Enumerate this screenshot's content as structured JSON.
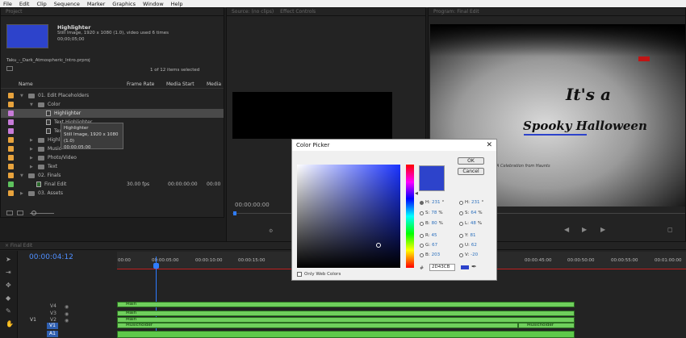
{
  "menu": [
    "File",
    "Edit",
    "Clip",
    "Sequence",
    "Marker",
    "Graphics",
    "Window",
    "Help"
  ],
  "project": {
    "tab_label": "Project",
    "preview_name": "Highlighter",
    "preview_info": "Still Image, 1920 x 1080 (1.0)",
    "preview_used": ", video used 6 times",
    "preview_duration": "00;00;05;00",
    "project_file": "Taku_-_Dark_Atmospheric_Intro.prproj",
    "selection_info": "1 of 12 items selected",
    "columns": [
      "Name",
      "Frame Rate",
      "Media Start",
      "Media"
    ],
    "rows": [
      {
        "label": "01. Edit Placeholders",
        "color": "#e8a33d",
        "type": "folder"
      },
      {
        "label": "Color",
        "color": "#e8a33d",
        "type": "folder"
      },
      {
        "label": "Highlighter",
        "color": "#c77bd8",
        "type": "file"
      },
      {
        "label": "Text Highlighter",
        "color": "#c77bd8",
        "type": "file"
      },
      {
        "label": "Text",
        "color": "#c77bd8",
        "type": "file"
      },
      {
        "label": "Highlighted Video",
        "color": "#e8a33d",
        "type": "folder"
      },
      {
        "label": "Music",
        "color": "#e8a33d",
        "type": "folder"
      },
      {
        "label": "Photo/Video",
        "color": "#e8a33d",
        "type": "folder"
      },
      {
        "label": "Text",
        "color": "#e8a33d",
        "type": "folder"
      },
      {
        "label": "02. Finals",
        "color": "#e8a33d",
        "type": "folder"
      },
      {
        "label": "Final Edit",
        "color": "#5ec25e",
        "type": "file"
      },
      {
        "label": "03. Assets",
        "color": "#e8a33d",
        "type": "folder"
      }
    ],
    "final_edit_fps": "30.00 fps",
    "final_edit_start": "00:00:00:00",
    "final_edit_media": "00:00",
    "tooltip": {
      "name": "Highlighter",
      "info": "Still Image, 1920 x 1080 (1.0)",
      "duration": "00:00:05:00"
    }
  },
  "source": {
    "tab_label": "Source: (no clips)",
    "tab_label2": "Effect Controls",
    "timecode": "00:00:00:00"
  },
  "program": {
    "tab_label": "Program: Final Edit",
    "title_line1": "It's a",
    "title_line2": "Spooky Halloween",
    "subtitle": "A Celebration from Haunts"
  },
  "timeline": {
    "timecode": "00:00:04:12",
    "ruler": [
      "00:00",
      "00:00:05:00",
      "00:00:10:00",
      "00:00:15:00",
      "00:00:45:00",
      "00:00:50:00",
      "00:00:55:00",
      "00:01:00:00"
    ],
    "tracks": [
      "V4",
      "V3",
      "V2",
      "V1",
      "A1"
    ],
    "source_patch": "V1",
    "clips": {
      "main1": "Main",
      "main2": "Main",
      "main3": "Main",
      "music1": "Musicholder",
      "music2": "Musicholder"
    }
  },
  "color_picker": {
    "title": "Color Picker",
    "ok": "OK",
    "cancel": "Cancel",
    "swatch_color": "#2D43CB",
    "only_web_colors": "Only Web Colors",
    "hex_value": "2D43CB",
    "fields_left": [
      {
        "label": "H:",
        "value": "231",
        "unit": "°"
      },
      {
        "label": "S:",
        "value": "78",
        "unit": "%"
      },
      {
        "label": "B:",
        "value": "80",
        "unit": "%"
      },
      {
        "label": "R:",
        "value": "45",
        "unit": ""
      },
      {
        "label": "G:",
        "value": "67",
        "unit": ""
      },
      {
        "label": "B:",
        "value": "203",
        "unit": ""
      }
    ],
    "fields_right": [
      {
        "label": "H:",
        "value": "231",
        "unit": "°"
      },
      {
        "label": "S:",
        "value": "64",
        "unit": "%"
      },
      {
        "label": "L:",
        "value": "48",
        "unit": "%"
      },
      {
        "label": "Y:",
        "value": "81",
        "unit": ""
      },
      {
        "label": "U:",
        "value": "62",
        "unit": ""
      },
      {
        "label": "V:",
        "value": "-20",
        "unit": ""
      }
    ]
  }
}
